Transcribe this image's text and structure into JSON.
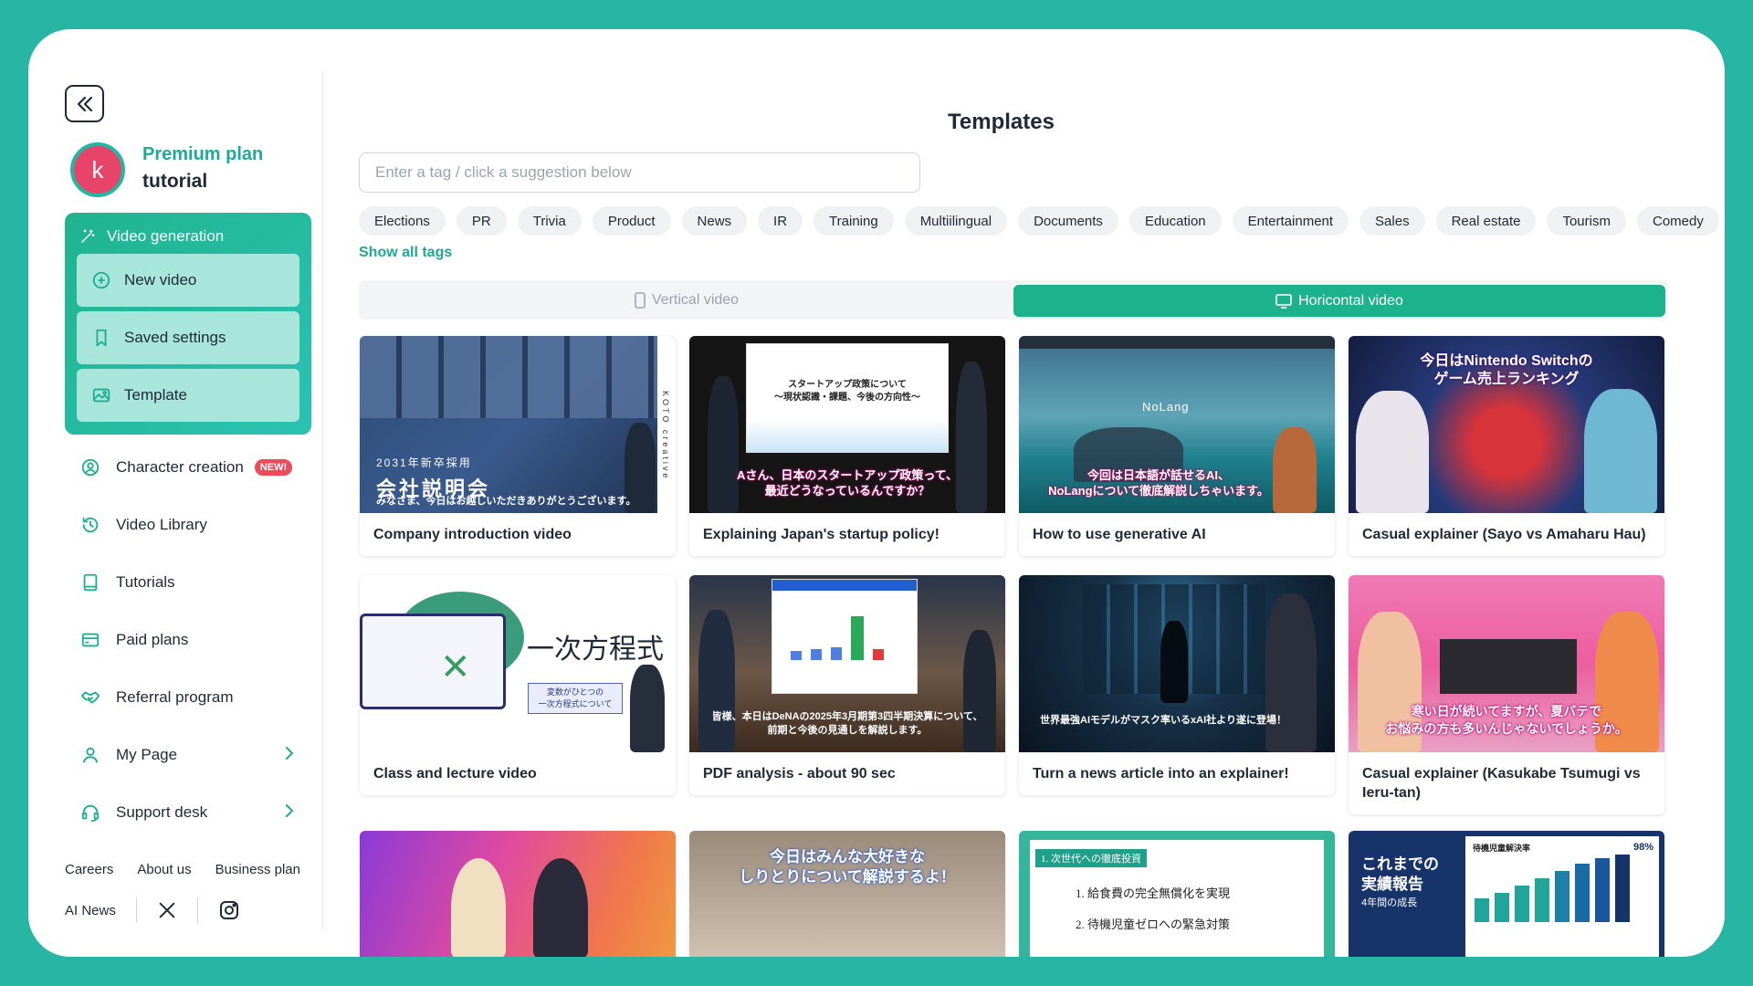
{
  "sidebar": {
    "avatar_letter": "k",
    "plan": "Premium plan",
    "user": "tutorial",
    "video_generation": {
      "header": "Video generation",
      "items": [
        "New video",
        "Saved settings",
        "Template"
      ]
    },
    "nav": [
      {
        "label": "Character creation",
        "icon": "character-icon",
        "badge": "NEW!"
      },
      {
        "label": "Video Library",
        "icon": "history-icon"
      },
      {
        "label": "Tutorials",
        "icon": "book-icon"
      },
      {
        "label": "Paid plans",
        "icon": "card-icon"
      },
      {
        "label": "Referral program",
        "icon": "handshake-icon"
      },
      {
        "label": "My Page",
        "icon": "user-icon"
      },
      {
        "label": "Support desk",
        "icon": "headset-icon"
      }
    ],
    "footer": {
      "links": [
        "Careers",
        "About us",
        "Business plan"
      ],
      "ai_news": "AI News"
    }
  },
  "main": {
    "title": "Templates",
    "search_placeholder": "Enter a tag / click a suggestion below",
    "tags": [
      "Elections",
      "PR",
      "Trivia",
      "Product",
      "News",
      "IR",
      "Training",
      "Multiilingual",
      "Documents",
      "Education",
      "Entertainment",
      "Sales",
      "Real estate",
      "Tourism",
      "Comedy"
    ],
    "show_all_tags": "Show all tags",
    "orientation": {
      "vertical": "Vertical video",
      "horizontal": "Horicontal video",
      "selected": "horizontal"
    },
    "cards": [
      {
        "title": "Company introduction video",
        "thumb_text_1": "2031年新卒採用",
        "thumb_text_2": "会社説明会",
        "thumb_caption": "みなさま、今日はお越しいただきありがとうございます。",
        "thumb_side": "KOTO creative"
      },
      {
        "title": "Explaining Japan's startup policy!",
        "thumb_slide_title": "スタートアップ政策について\n〜現状認識・課題、今後の方向性〜",
        "thumb_caption": "Aさん、日本のスタートアップ政策って、\n最近どうなっているんですか？"
      },
      {
        "title": "How to use generative AI",
        "thumb_logo": "NoLang",
        "thumb_caption": "今回は日本語が話せるAI、\nNoLangについて徹底解説しちゃいます。"
      },
      {
        "title": "Casual explainer (Sayo vs Amaharu Hau)",
        "thumb_caption": "今日はNintendo Switchの\nゲーム売上ランキング"
      },
      {
        "title": "Class and lecture video",
        "thumb_big": "一次方程式",
        "thumb_box": "変数がひとつの\n一次方程式について"
      },
      {
        "title": "PDF analysis - about 90 sec",
        "thumb_caption": "皆様、本日はDeNAの2025年3月期第3四半期決算について、\n前期と今後の見通しを解説します。"
      },
      {
        "title": "Turn a news article into an explainer!",
        "thumb_caption": "世界最強AIモデルがマスク率いるxAI社より遂に登場！"
      },
      {
        "title": "Casual explainer (Kasukabe Tsumugi vs Ieru-tan)",
        "thumb_caption": "寒い日が続いてますが、夏バテで\nお悩みの方も多いんじゃないでしょうか。"
      },
      {
        "title": ""
      },
      {
        "title": "",
        "thumb_caption": "今日はみんな大好きな\nしりとりについて解説するよ！"
      },
      {
        "title": "",
        "thumb_heading": "1. 次世代への徹底投資",
        "thumb_line_1": "1. 給食費の完全無償化を実現",
        "thumb_line_2": "2. 待機児童ゼロへの緊急対策"
      },
      {
        "title": "",
        "thumb_text_1": "これまでの",
        "thumb_text_2": "実績報告",
        "thumb_text_3": "4年間の成長",
        "thumb_chart_title": "待機児童解決率",
        "thumb_value": "98%"
      }
    ]
  }
}
